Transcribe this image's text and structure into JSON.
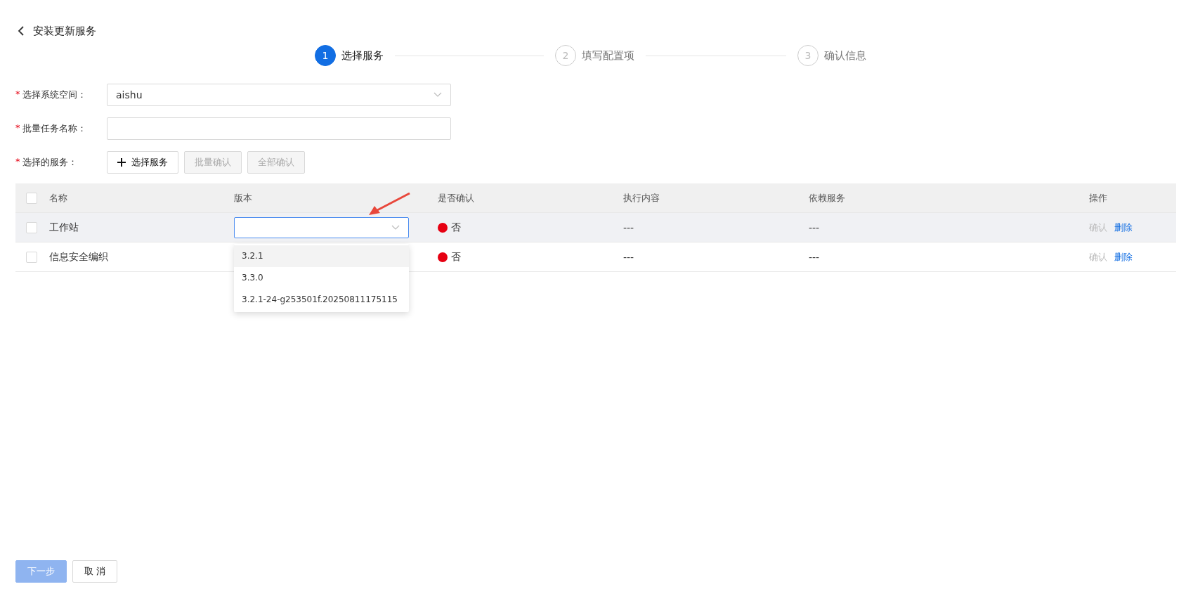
{
  "header": {
    "title": "安装更新服务"
  },
  "steps": [
    {
      "number": "1",
      "label": "选择服务",
      "active": true
    },
    {
      "number": "2",
      "label": "填写配置项",
      "active": false
    },
    {
      "number": "3",
      "label": "确认信息",
      "active": false
    }
  ],
  "form": {
    "fields": [
      {
        "kind": "select",
        "required_mark": "*",
        "label": "选择系统空间：",
        "value": "aishu"
      },
      {
        "kind": "input",
        "required_mark": "*",
        "label": "批量任务名称："
      },
      {
        "kind": "buttons",
        "required_mark": "*",
        "label": "选择的服务：",
        "buttons": [
          {
            "kind": "add",
            "label": "选择服务",
            "disabled": false
          },
          {
            "kind": "plain",
            "label": "批量确认",
            "disabled": true
          },
          {
            "kind": "plain",
            "label": "全部确认",
            "disabled": true
          }
        ]
      }
    ]
  },
  "table": {
    "all_checked": false,
    "columns": [
      "名称",
      "版本",
      "是否确认",
      "执行内容",
      "依赖服务",
      "操作"
    ],
    "rows": [
      {
        "checked": false,
        "highlighted": true,
        "name": "工作站",
        "version_open": true,
        "confirmed": "否",
        "color": "#e60012",
        "exec": "---",
        "deps": "---",
        "actions": [
          {
            "label": "确认",
            "disabled": true
          },
          {
            "label": "删除",
            "disabled": false
          }
        ]
      },
      {
        "checked": false,
        "highlighted": false,
        "name": "信息安全编织",
        "version_open": false,
        "confirmed": "否",
        "color": "#e60012",
        "exec": "---",
        "deps": "---",
        "actions": [
          {
            "label": "确认",
            "disabled": true
          },
          {
            "label": "删除",
            "disabled": false
          }
        ]
      }
    ],
    "version_options": [
      {
        "label": "3.2.1",
        "highlighted": true
      },
      {
        "label": "3.3.0",
        "highlighted": false
      },
      {
        "label": "3.2.1-24-g253501f.20250811175115",
        "highlighted": false
      }
    ]
  },
  "footer": [
    {
      "label": "下一步",
      "kind": "primary",
      "disabled": true
    },
    {
      "label": "取 消",
      "kind": "default",
      "disabled": false
    }
  ]
}
